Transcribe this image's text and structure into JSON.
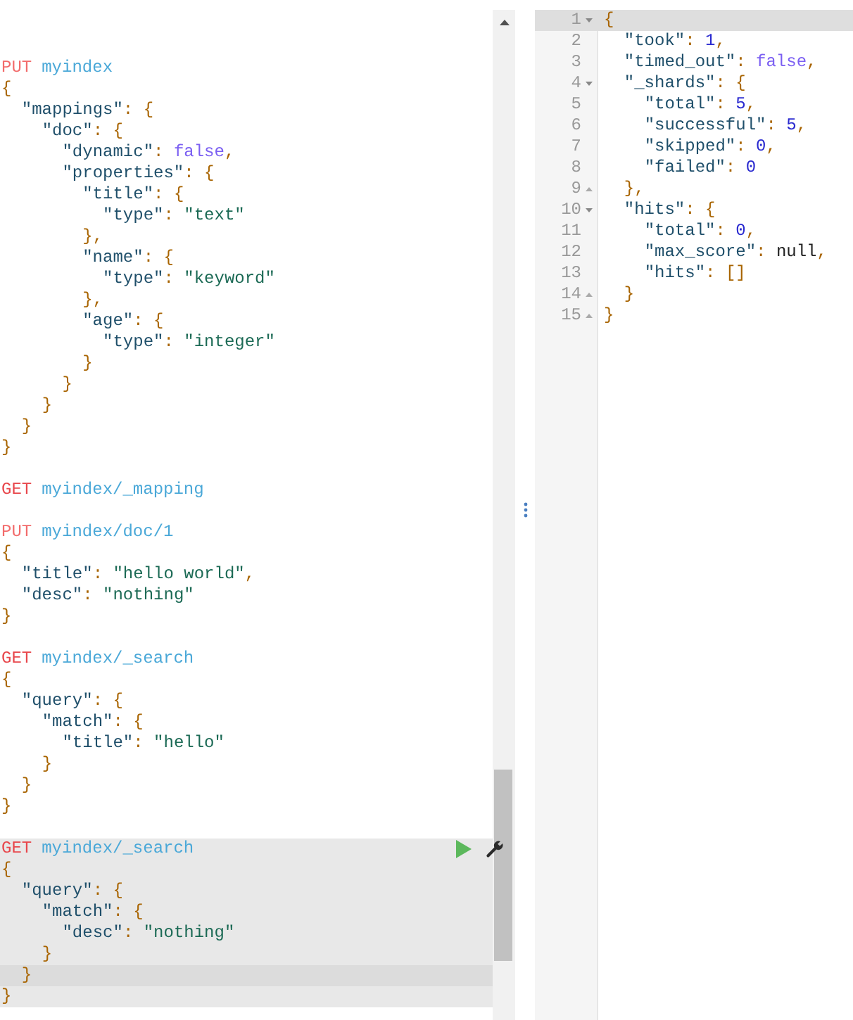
{
  "requests": [
    {
      "method": "PUT",
      "path": "myindex",
      "selected": false,
      "body": [
        "{",
        "  \"mappings\": {",
        "    \"doc\": {",
        "      \"dynamic\": false,",
        "      \"properties\": {",
        "        \"title\": {",
        "          \"type\": \"text\"",
        "        },",
        "        \"name\": {",
        "          \"type\": \"keyword\"",
        "        },",
        "        \"age\": {",
        "          \"type\": \"integer\"",
        "        }",
        "      }",
        "    }",
        "  }",
        "}"
      ]
    },
    {
      "method": "GET",
      "path": "myindex/_mapping",
      "selected": false
    },
    {
      "method": "PUT",
      "path": "myindex/doc/1",
      "selected": false,
      "body": [
        "{",
        "  \"title\": \"hello world\",",
        "  \"desc\": \"nothing\"",
        "}"
      ]
    },
    {
      "method": "GET",
      "path": "myindex/_search",
      "selected": false,
      "body": [
        "{",
        "  \"query\": {",
        "    \"match\": {",
        "      \"title\": \"hello\"",
        "    }",
        "  }",
        "}"
      ]
    },
    {
      "method": "GET",
      "path": "myindex/_search",
      "selected": true,
      "body": [
        "{",
        "  \"query\": {",
        "    \"match\": {",
        "      \"desc\": \"nothing\"",
        "    }",
        "  }",
        "}"
      ]
    }
  ],
  "response": [
    {
      "number": "1",
      "text": "{",
      "kind": "foldstart",
      "active": true
    },
    {
      "number": "2",
      "text": "  \"took\": 1,",
      "kind": "plain",
      "active": false
    },
    {
      "number": "3",
      "text": "  \"timed_out\": false,",
      "kind": "plain",
      "active": false
    },
    {
      "number": "4",
      "text": "  \"_shards\": {",
      "kind": "foldstart",
      "active": false
    },
    {
      "number": "5",
      "text": "    \"total\": 5,",
      "kind": "plain",
      "active": false
    },
    {
      "number": "6",
      "text": "    \"successful\": 5,",
      "kind": "plain",
      "active": false
    },
    {
      "number": "7",
      "text": "    \"skipped\": 0,",
      "kind": "plain",
      "active": false
    },
    {
      "number": "8",
      "text": "    \"failed\": 0",
      "kind": "plain",
      "active": false
    },
    {
      "number": "9",
      "text": "  },",
      "kind": "foldend",
      "active": false
    },
    {
      "number": "10",
      "text": "  \"hits\": {",
      "kind": "foldstart",
      "active": false
    },
    {
      "number": "11",
      "text": "    \"total\": 0,",
      "kind": "plain",
      "active": false
    },
    {
      "number": "12",
      "text": "    \"max_score\": null,",
      "kind": "plain",
      "active": false
    },
    {
      "number": "13",
      "text": "    \"hits\": []",
      "kind": "plain",
      "active": false
    },
    {
      "number": "14",
      "text": "  }",
      "kind": "foldend",
      "active": false
    },
    {
      "number": "15",
      "text": "}",
      "kind": "foldend",
      "active": false
    }
  ]
}
